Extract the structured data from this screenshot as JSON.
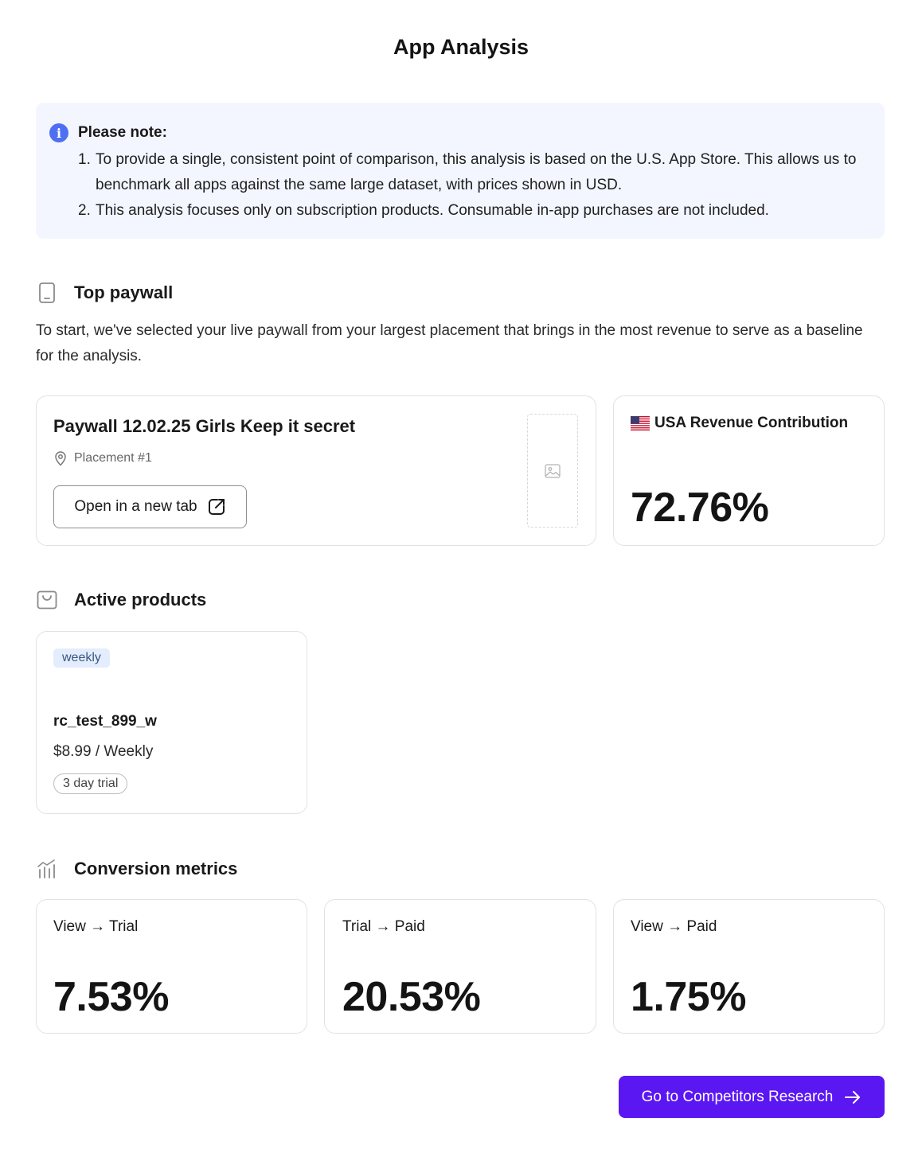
{
  "page": {
    "title": "App Analysis"
  },
  "note": {
    "title": "Please note:",
    "items": [
      {
        "num": "1.",
        "text": "To provide a single, consistent point of comparison, this analysis is based on the U.S. App Store. This allows us to benchmark all apps against the same large dataset, with prices shown in USD."
      },
      {
        "num": "2.",
        "text": "This analysis focuses only on subscription products. Consumable in-app purchases are not included."
      }
    ]
  },
  "top_paywall": {
    "title": "Top paywall",
    "description": "To start, we've selected your live paywall from your largest placement that brings in the most revenue to serve as a baseline for the analysis.",
    "paywall_name": "Paywall 12.02.25 Girls Keep it secret",
    "placement": "Placement #1",
    "open_button_label": "Open in a new tab",
    "revenue_title": "USA Revenue Contribution",
    "revenue_value": "72.76%"
  },
  "active_products": {
    "title": "Active products",
    "products": [
      {
        "tag": "weekly",
        "name": "rc_test_899_w",
        "price": "$8.99 / Weekly",
        "trial": "3 day trial"
      }
    ]
  },
  "conversion_metrics": {
    "title": "Conversion metrics",
    "metrics": [
      {
        "label": "View → Trial",
        "value": "7.53%"
      },
      {
        "label": "Trial → Paid",
        "value": "20.53%"
      },
      {
        "label": "View → Paid",
        "value": "1.75%"
      }
    ]
  },
  "cta": {
    "label": "Go to Competitors Research"
  },
  "colors": {
    "accent": "#5b17f2",
    "info": "#4f6ff2",
    "note_bg": "#f3f6ff",
    "tag_bg": "#e3edfd"
  },
  "icons": [
    "info-icon",
    "phone-icon",
    "location-pin-icon",
    "external-link-icon",
    "image-placeholder-icon",
    "us-flag-icon",
    "shopping-bag-icon",
    "chart-icon",
    "arrow-right-icon"
  ]
}
